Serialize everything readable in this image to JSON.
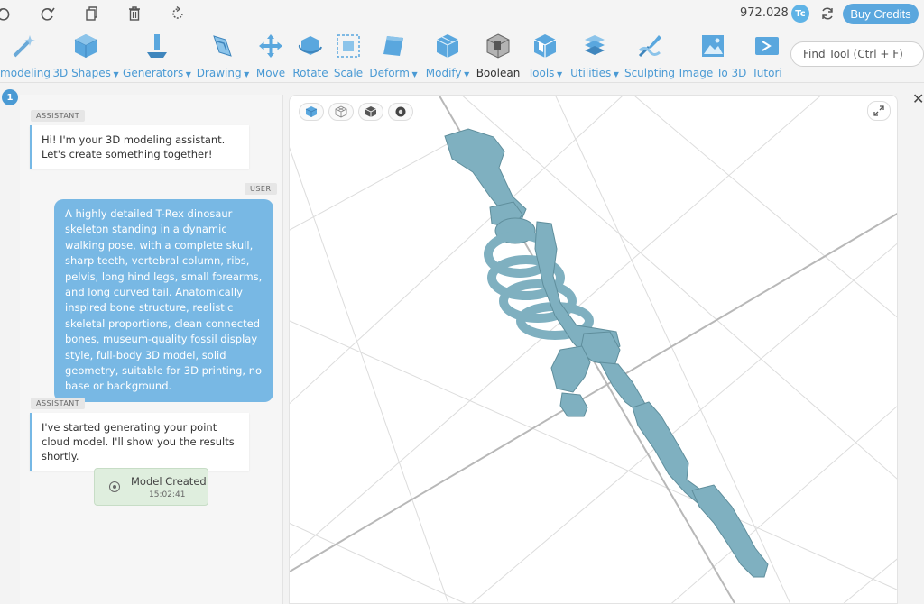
{
  "topbar": {
    "credits": "972.028",
    "credit_badge": "Tc",
    "buy_label": "Buy Credits"
  },
  "toolbar": {
    "tools": [
      {
        "label": "modeling",
        "icon": "magic-wand-icon",
        "has_menu": false
      },
      {
        "label": "3D Shapes",
        "icon": "cube-icon",
        "has_menu": true
      },
      {
        "label": "Generators",
        "icon": "generator-icon",
        "has_menu": true
      },
      {
        "label": "Drawing",
        "icon": "drawing-icon",
        "has_menu": true
      },
      {
        "label": "Move",
        "icon": "move-icon",
        "has_menu": false
      },
      {
        "label": "Rotate",
        "icon": "rotate-icon",
        "has_menu": false
      },
      {
        "label": "Scale",
        "icon": "scale-icon",
        "has_menu": false
      },
      {
        "label": "Deform",
        "icon": "deform-icon",
        "has_menu": true
      },
      {
        "label": "Modify",
        "icon": "modify-icon",
        "has_menu": true
      },
      {
        "label": "Boolean",
        "icon": "boolean-icon",
        "has_menu": false
      },
      {
        "label": "Tools",
        "icon": "tools-icon",
        "has_menu": true
      },
      {
        "label": "Utilities",
        "icon": "utilities-icon",
        "has_menu": true
      },
      {
        "label": "Sculpting",
        "icon": "sculpting-icon",
        "has_menu": false
      },
      {
        "label": "Image To 3D",
        "icon": "image-to-3d-icon",
        "has_menu": false
      },
      {
        "label": "Tutori",
        "icon": "tutorial-icon",
        "has_menu": false
      }
    ],
    "find_tool_placeholder": "Find Tool (Ctrl + F)"
  },
  "chat": {
    "badge_count": "1",
    "messages": [
      {
        "role": "ASSISTANT",
        "text": "Hi! I'm your 3D modeling assistant. Let's create something together!"
      },
      {
        "role": "USER",
        "text": "A highly detailed T-Rex dinosaur skeleton standing in a dynamic walking pose, with a complete skull, sharp teeth, vertebral column, ribs, pelvis, long hind legs, small forearms, and long curved tail. Anatomically inspired bone structure, realistic skeletal proportions, clean connected bones, museum-quality fossil display style, full-body 3D model, solid geometry, suitable for 3D printing, no base or background."
      },
      {
        "role": "ASSISTANT",
        "text": "I've started generating your point cloud model. I'll show you the results shortly."
      }
    ],
    "status": {
      "title": "Model Created",
      "time": "15:02:41"
    }
  },
  "viewport": {
    "view_modes": [
      "solid-view-icon",
      "wireframe-view-icon",
      "shaded-view-icon",
      "points-view-icon"
    ],
    "model_color": "#7fb0c0"
  },
  "colors": {
    "accent": "#4a9ad4",
    "user_bubble": "#78b8e4",
    "status_bg": "#dfeede"
  }
}
